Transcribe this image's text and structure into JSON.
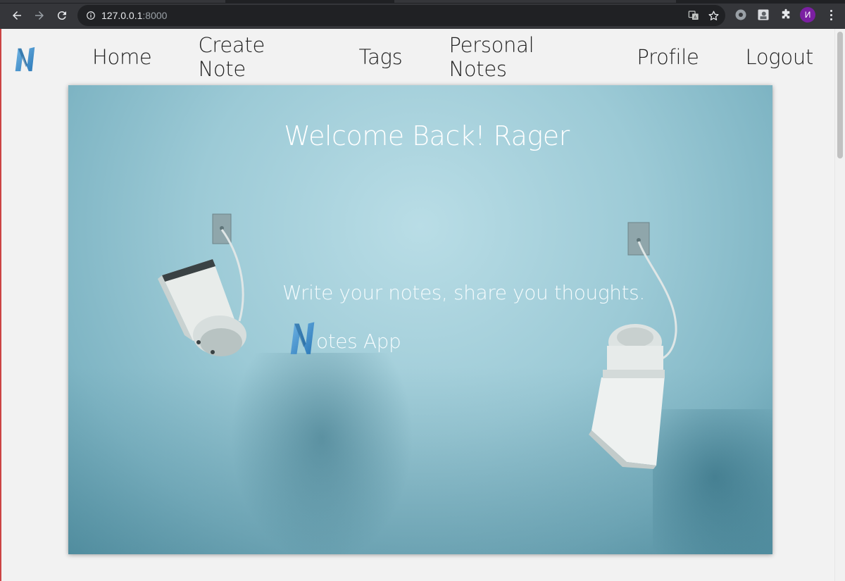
{
  "browser": {
    "url_host": "127.0.0.1",
    "url_port": ":8000",
    "profile_initial": "И"
  },
  "nav": {
    "items": [
      {
        "label": "Home"
      },
      {
        "label": "Create Note"
      },
      {
        "label": "Tags"
      },
      {
        "label": "Personal Notes"
      },
      {
        "label": "Profile"
      },
      {
        "label": "Logout"
      }
    ]
  },
  "hero": {
    "welcome": "Welcome Back! Rager",
    "tagline": "Write your notes, share you thoughts.",
    "brand_suffix": "otes App"
  },
  "colors": {
    "brand_blue": "#3a8fd0",
    "chrome_bg": "#35363a"
  }
}
